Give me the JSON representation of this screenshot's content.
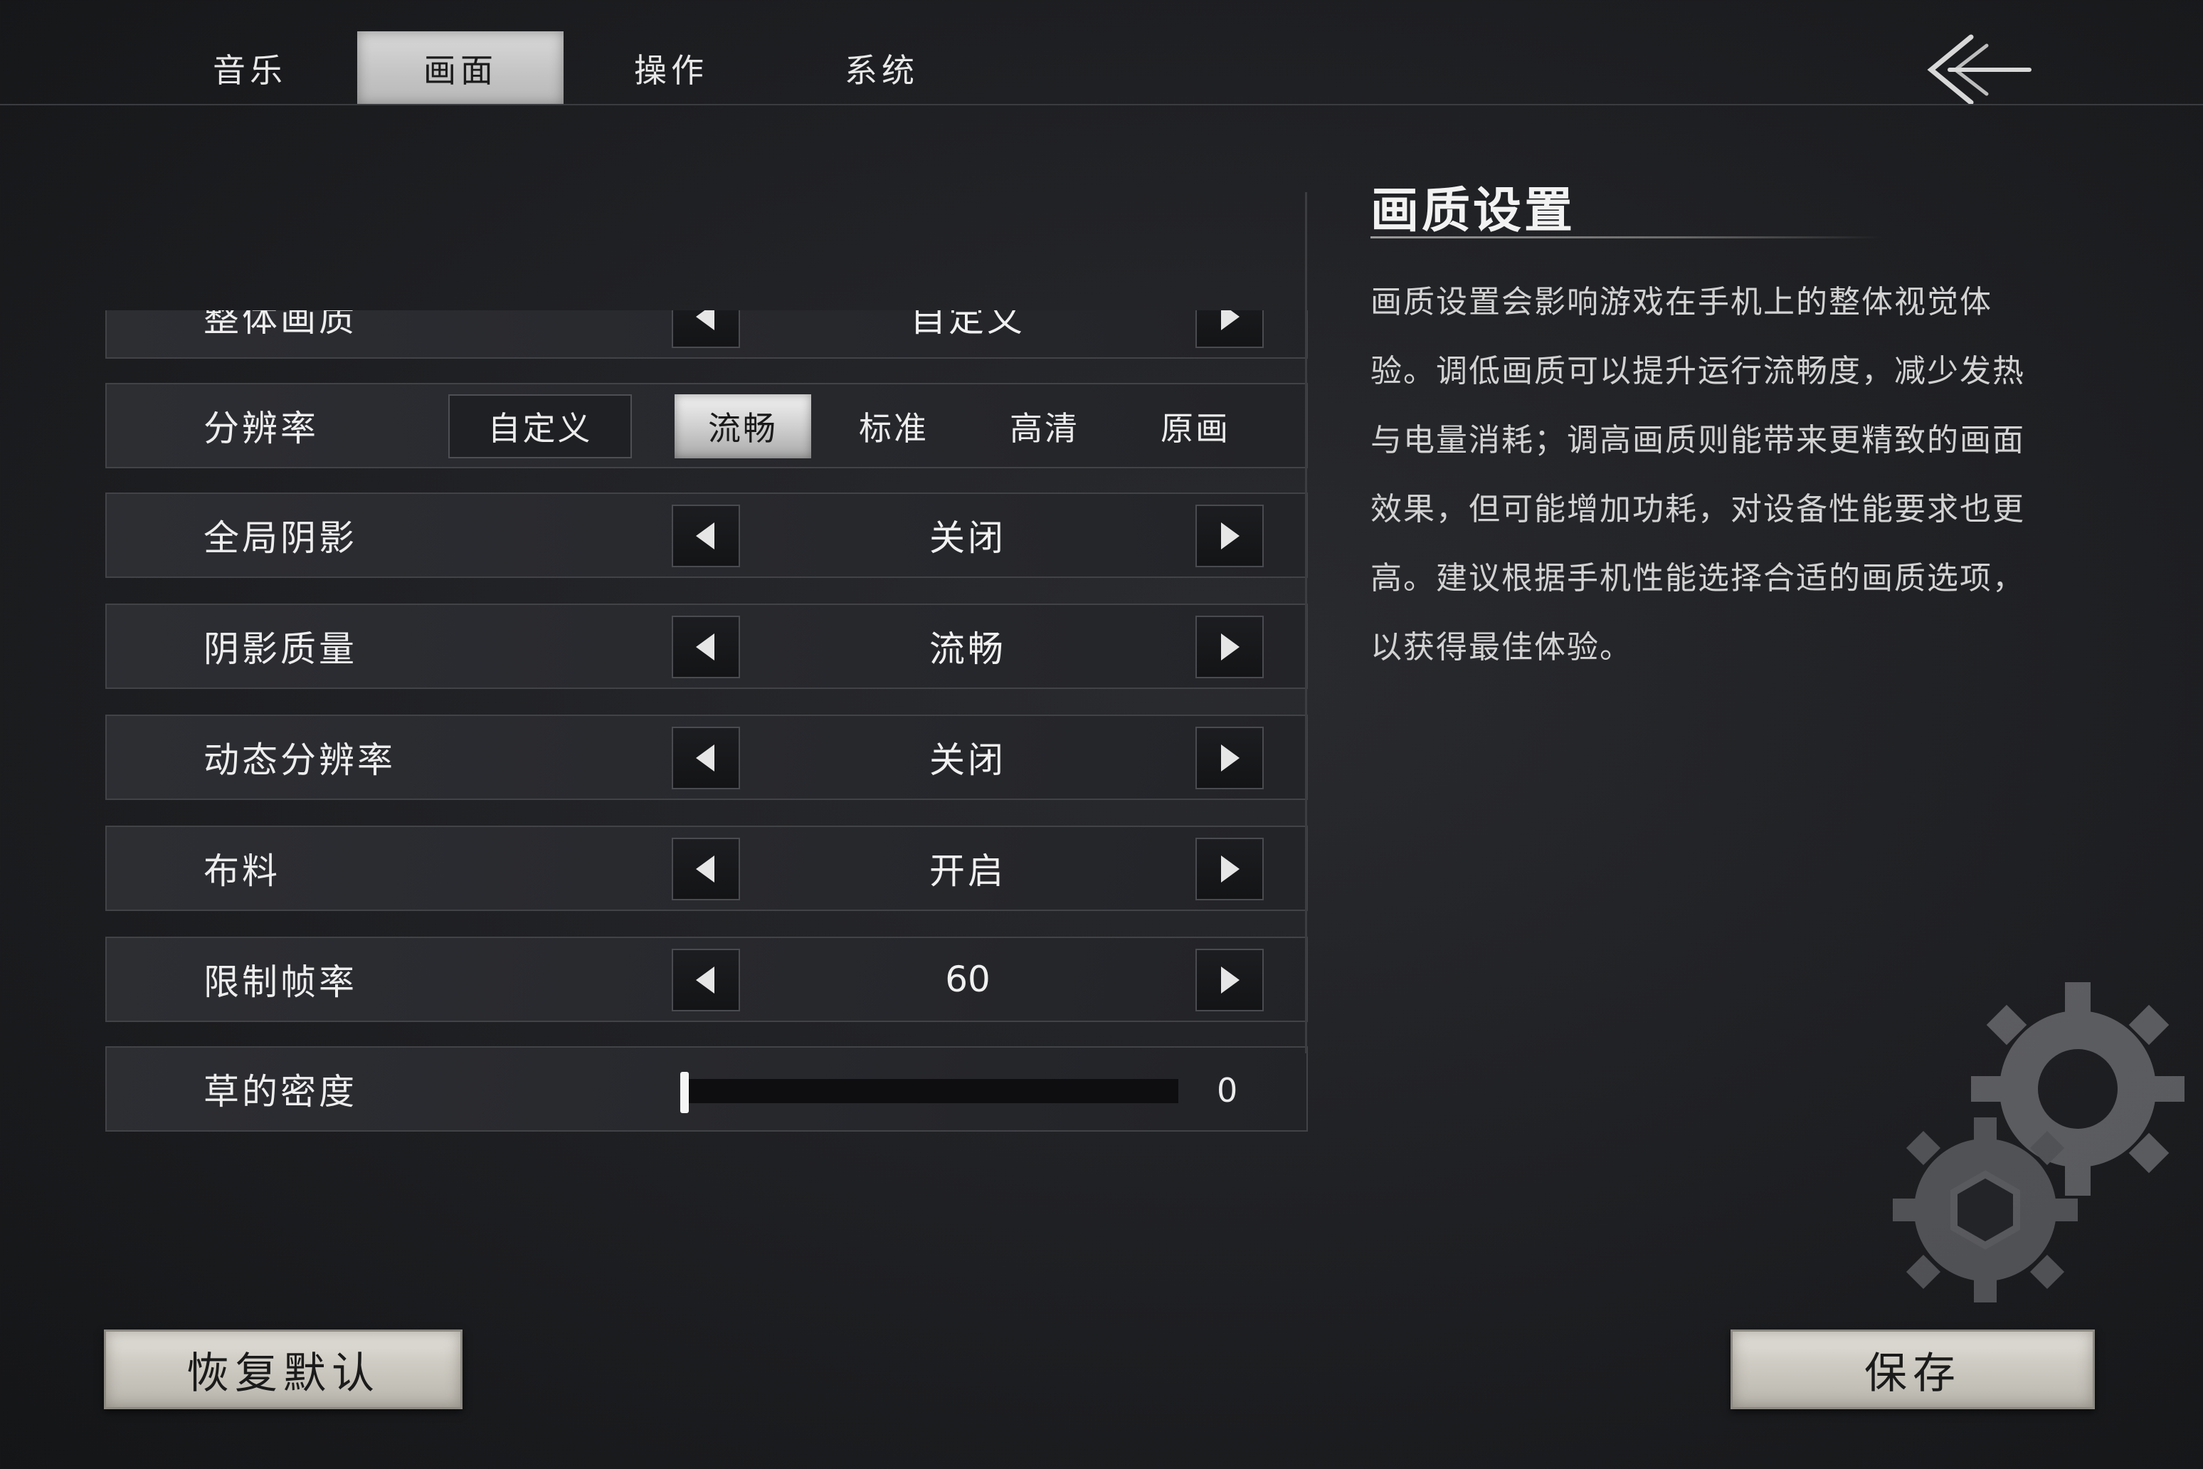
{
  "tabs": [
    {
      "label": "音乐"
    },
    {
      "label": "画面"
    },
    {
      "label": "操作"
    },
    {
      "label": "系统"
    }
  ],
  "active_tab": "画面",
  "back_icon": "back-arrow-icon",
  "clipped_row": {
    "label": "整体画质",
    "value": "自定义"
  },
  "resolution": {
    "label": "分辨率",
    "custom_label": "自定义",
    "options": [
      "流畅",
      "标准",
      "高清",
      "原画"
    ],
    "selected": "流畅"
  },
  "rows": [
    {
      "label": "全局阴影",
      "value": "关闭"
    },
    {
      "label": "阴影质量",
      "value": "流畅"
    },
    {
      "label": "动态分辨率",
      "value": "关闭"
    },
    {
      "label": "布料",
      "value": "开启"
    },
    {
      "label": "限制帧率",
      "value": "60"
    }
  ],
  "grass": {
    "label": "草的密度",
    "value": "0",
    "fraction": 0
  },
  "info": {
    "title": "画质设置",
    "body": "画质设置会影响游戏在手机上的整体视觉体验。调低画质可以提升运行流畅度，减少发热与电量消耗；调高画质则能带来更精致的画面效果，但可能增加功耗，对设备性能要求也更高。建议根据手机性能选择合适的画质选项，以获得最佳体验。"
  },
  "buttons": {
    "reset": "恢复默认",
    "save": "保存"
  },
  "colors": {
    "background": "#1e1f22",
    "active_tab": "#c8c8c8",
    "button_paper": "#cfccc4"
  }
}
